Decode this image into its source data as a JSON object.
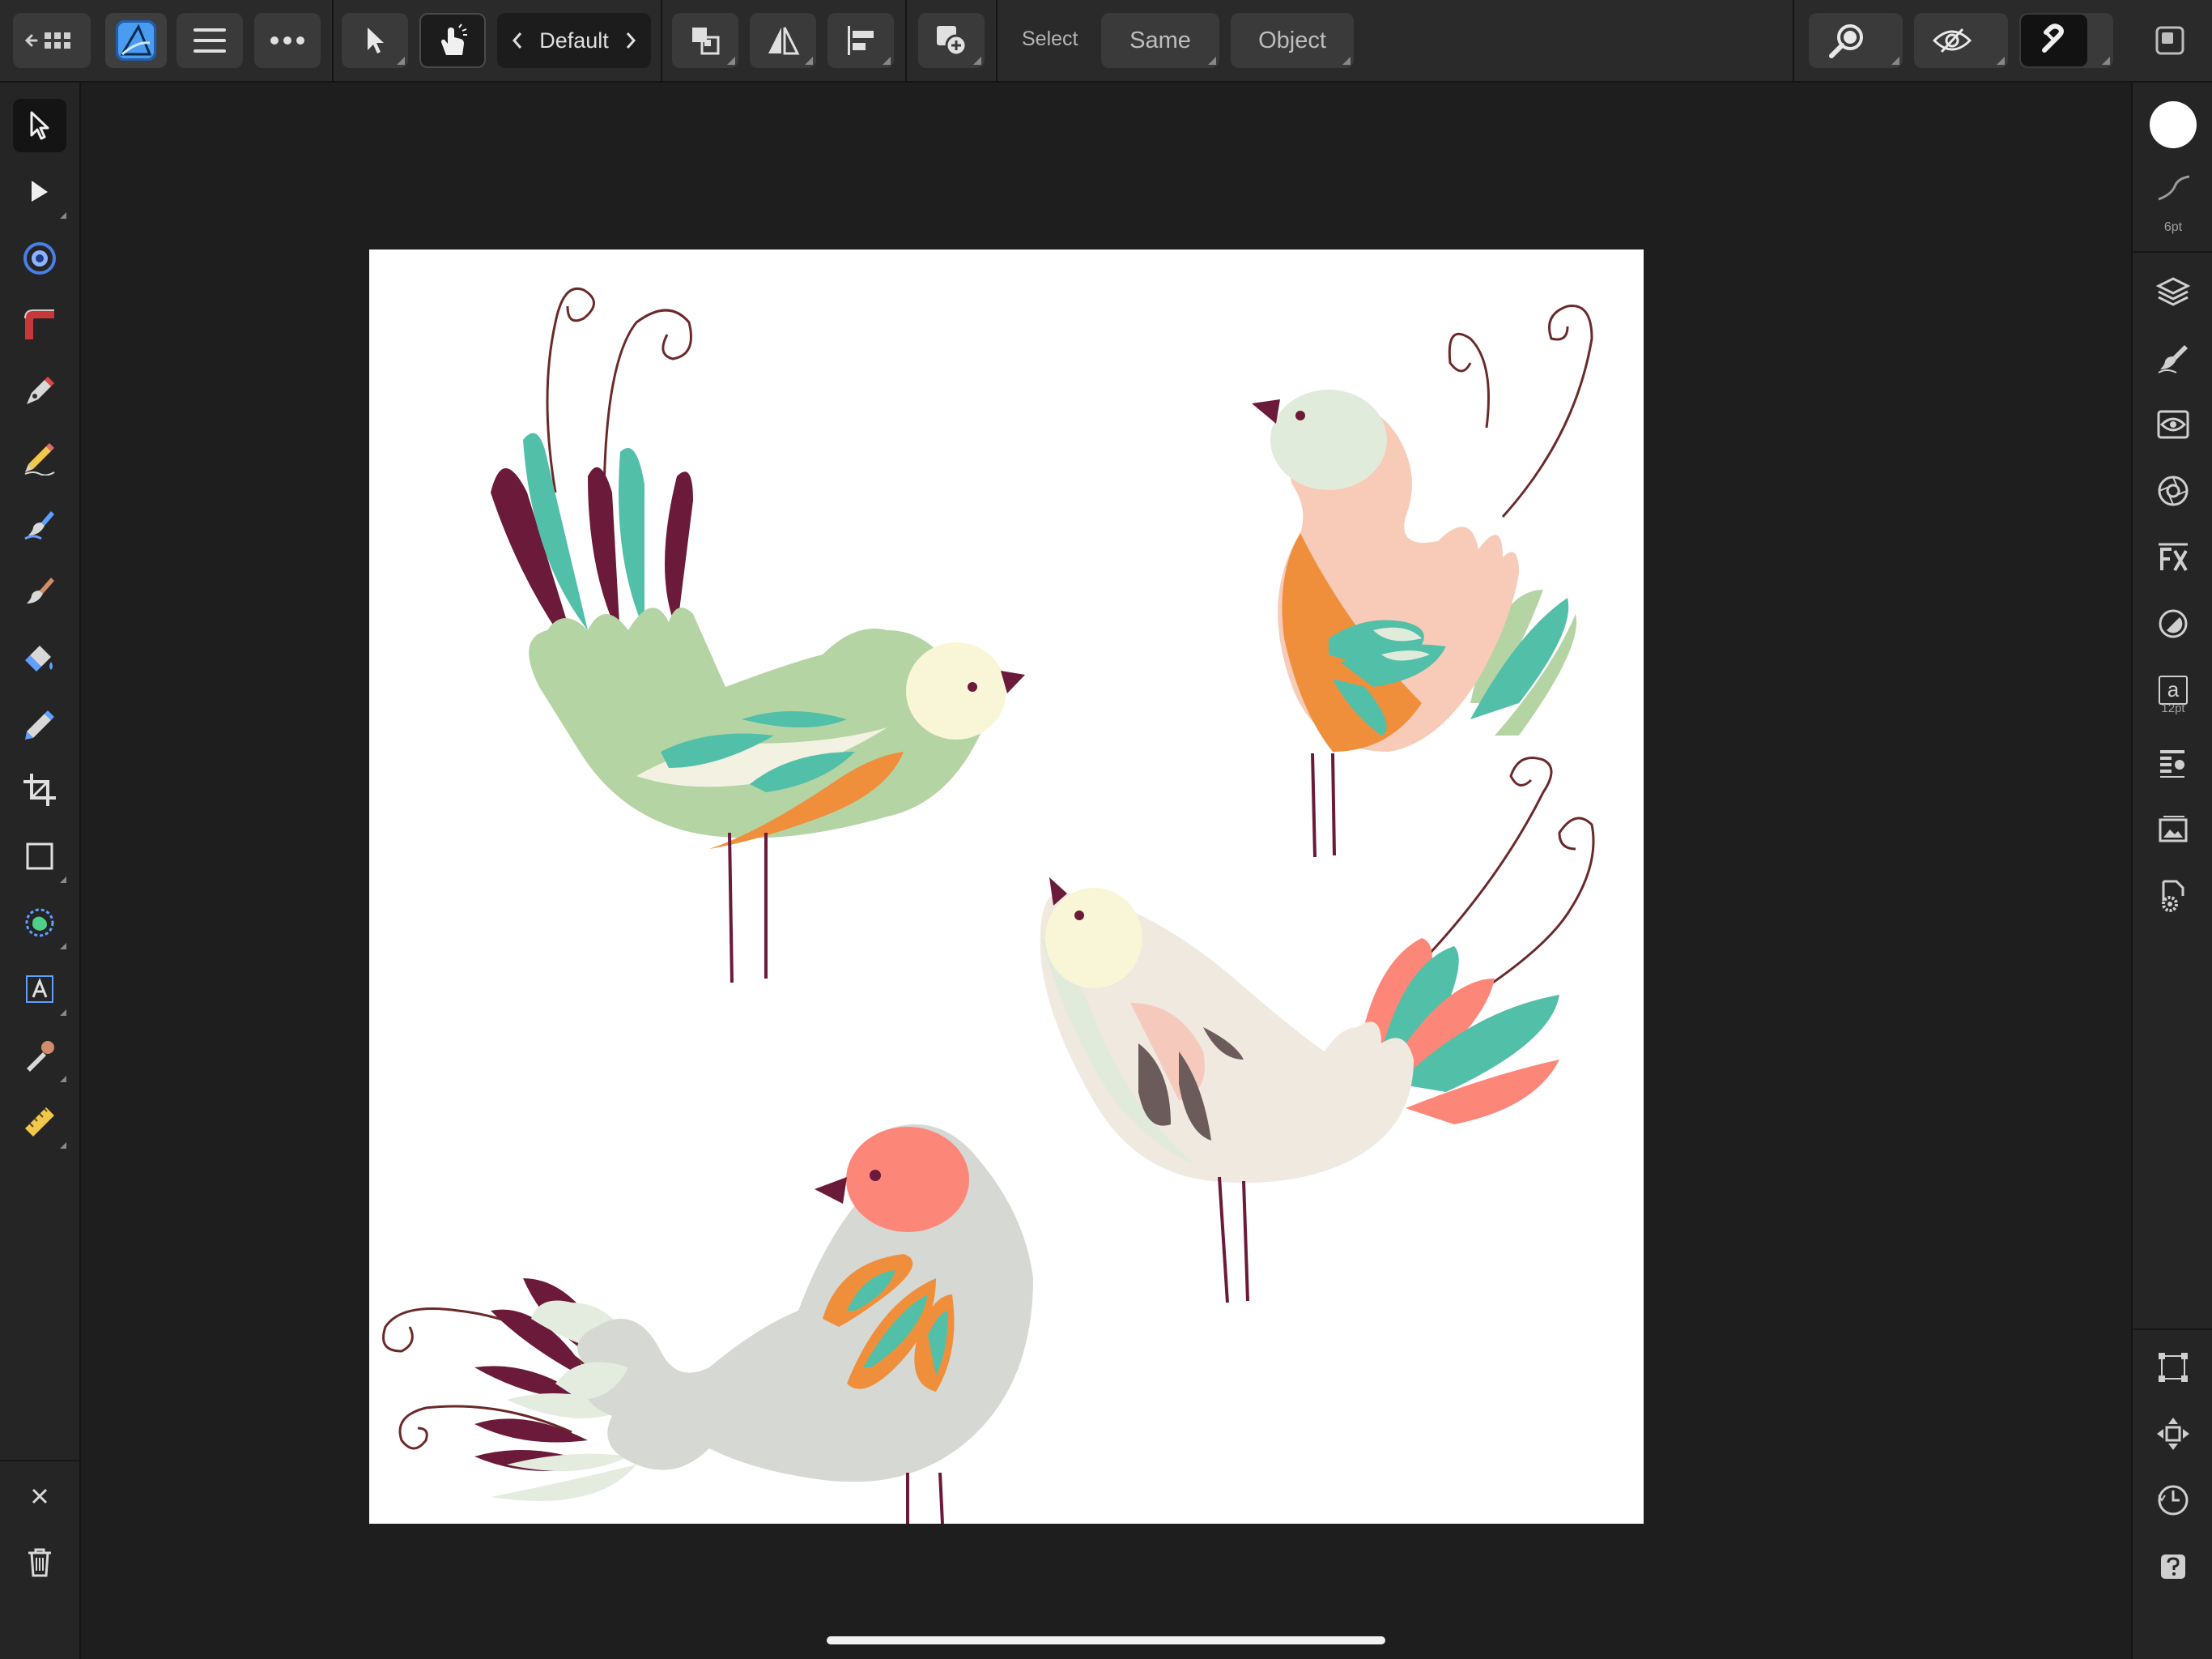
{
  "topbar": {
    "persona": "Default",
    "select_label": "Select",
    "same_label": "Same",
    "object_label": "Object"
  },
  "right_panel": {
    "stroke_width": "6pt",
    "text_size": "12pt",
    "text_icon_letter": "a"
  },
  "colors": {
    "accent_blue": "#4a9cf0",
    "bird_green": "#b4d4a4",
    "bird_teal": "#52bfa8",
    "bird_plum": "#6b1a3a",
    "bird_orange": "#ef8f3c",
    "bird_peach": "#f7cbb8",
    "bird_coral": "#fc8778",
    "bird_cream": "#f8f6d6",
    "bird_grey": "#d6d8d4",
    "bird_beige": "#efe9e0"
  },
  "icons": {
    "left_tools": [
      "move-tool-icon",
      "node-tool-icon",
      "corner-tool-icon",
      "shape-gradient-icon",
      "pen-tool-icon",
      "pencil-tool-icon",
      "vector-brush-icon",
      "paint-brush-icon",
      "fill-tool-icon",
      "transparency-tool-icon",
      "crop-tool-icon",
      "rectangle-tool-icon",
      "shape-builder-icon",
      "artistic-text-icon",
      "color-picker-icon",
      "measure-tool-icon"
    ]
  }
}
